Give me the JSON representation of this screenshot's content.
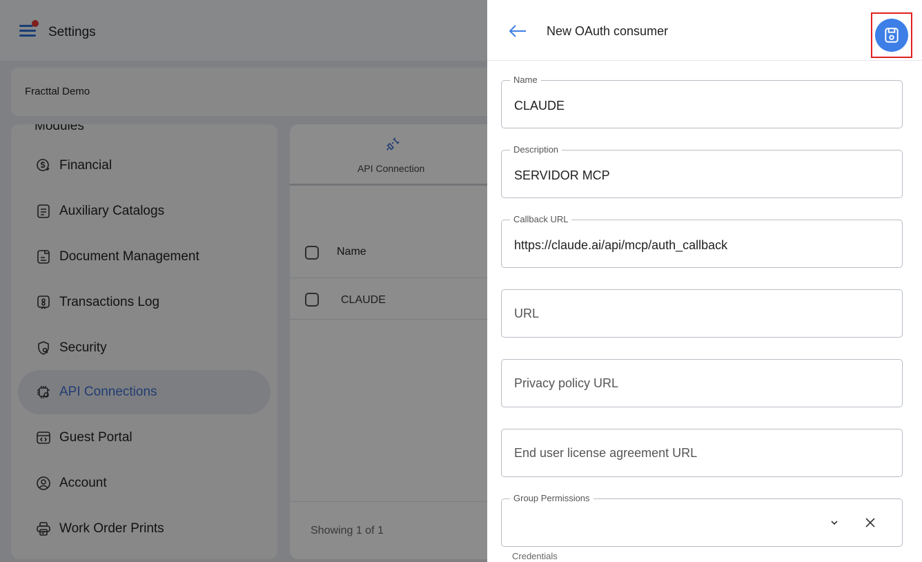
{
  "app": {
    "title": "Settings",
    "company": "Fracttal Demo",
    "sidebar": {
      "cut_item": "Modules",
      "items": [
        {
          "label": "Financial",
          "icon": "financial-icon",
          "active": false
        },
        {
          "label": "Auxiliary Catalogs",
          "icon": "catalog-icon",
          "active": false
        },
        {
          "label": "Document Management",
          "icon": "document-icon",
          "active": false
        },
        {
          "label": "Transactions Log",
          "icon": "transactions-log-icon",
          "active": false
        },
        {
          "label": "Security",
          "icon": "shield-icon",
          "active": false
        },
        {
          "label": "API Connections",
          "icon": "api-chip-icon",
          "active": true
        },
        {
          "label": "Guest Portal",
          "icon": "guest-portal-icon",
          "active": false
        },
        {
          "label": "Account",
          "icon": "account-icon",
          "active": false
        },
        {
          "label": "Work Order Prints",
          "icon": "printer-icon",
          "active": false
        }
      ]
    },
    "main": {
      "tab_label": "API Connection",
      "column_name": "Name",
      "rows": [
        "CLAUDE"
      ],
      "footer": "Showing 1 of 1"
    }
  },
  "panel": {
    "title": "New OAuth consumer",
    "fields": {
      "name": {
        "label": "Name",
        "value": "CLAUDE"
      },
      "description": {
        "label": "Description",
        "value": "SERVIDOR MCP"
      },
      "callback": {
        "label": "Callback URL",
        "value": "https://claude.ai/api/mcp/auth_callback"
      },
      "url": {
        "placeholder": "URL"
      },
      "privacy": {
        "placeholder": "Privacy policy URL"
      },
      "eula": {
        "placeholder": "End user license agreement URL"
      },
      "group": {
        "label": "Group Permissions",
        "value": ""
      }
    },
    "credentials_label": "Credentials"
  },
  "colors": {
    "accent": "#3d7fe6",
    "highlight_box": "#e02020",
    "active_text": "#3d6fd1"
  }
}
